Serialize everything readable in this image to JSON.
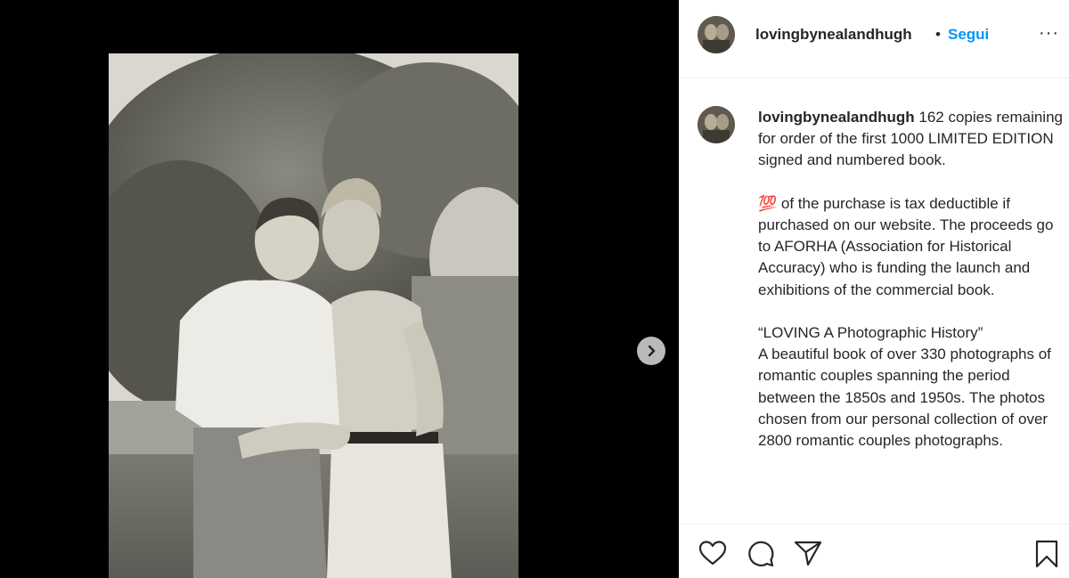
{
  "post": {
    "username": "lovingbynealandhugh",
    "separator": "•",
    "follow_label": "Segui",
    "more_label": "···"
  },
  "caption": {
    "username": "lovingbynealandhugh",
    "para1_rest": " 162 copies remaining for order of the first 1000 LIMITED EDITION signed and numbered book.",
    "para2_emoji": "💯",
    "para2_rest": " of the purchase is tax deductible if purchased on our website. The proceeds go to AFORHA (Association for Historical Accuracy) who is funding the launch and exhibitions of the commercial book.",
    "para3_title": "“LOVING A Photographic History”",
    "para3_rest": "A beautiful book of over 330 photographs of romantic couples spanning the period between the 1850s and 1950s. The photos chosen from our personal collection of over 2800 romantic couples photographs."
  },
  "media": {
    "photo_icon": "vintage-photo-two-men",
    "next_icon": "chevron-right-icon"
  },
  "actions": {
    "icons": [
      "heart-icon",
      "comment-icon",
      "share-icon",
      "bookmark-icon"
    ]
  },
  "colors": {
    "accent": "#0095f6",
    "text": "#262626",
    "media_background": "#000000",
    "divider": "#efefef"
  }
}
